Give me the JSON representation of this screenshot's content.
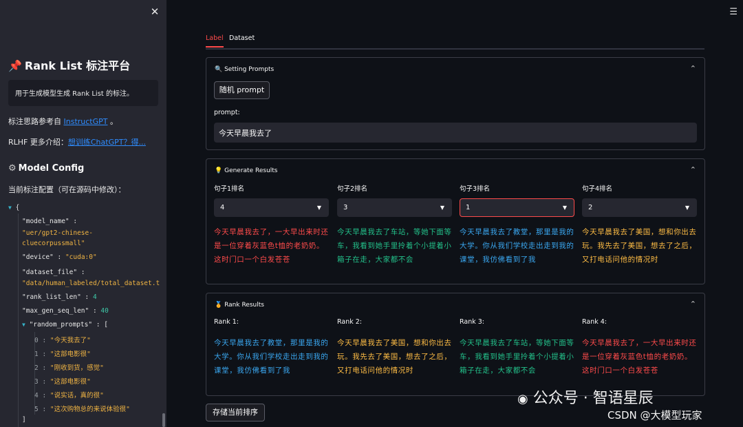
{
  "sidebar": {
    "close_icon": "close-icon",
    "title_icon": "pushpin-icon",
    "title": "Rank List 标注平台",
    "description": "用于生成模型生成 Rank List 的标注。",
    "ref_prefix": "标注思路参考自",
    "ref_link": "InstructGPT",
    "ref_suffix": "。",
    "rlhf_prefix": "RLHF 更多介绍：",
    "rlhf_link": "想训练ChatGPT？得...",
    "config_icon": "gear-icon",
    "config_title": "Model Config",
    "config_caption": "当前标注配置（可在源码中修改）："
  },
  "json": {
    "open": "{",
    "close": "]",
    "model_name_key": "\"model_name\" :",
    "model_name_val_1": "\"uer/gpt2-chinese-",
    "model_name_val_2": "cluecorpussmall\"",
    "device_key": "\"device\" :",
    "device_val": "\"cuda:0\"",
    "dataset_key": "\"dataset_file\" :",
    "dataset_val": "\"data/human_labeled/total_dataset.t",
    "rank_len_key": "\"rank_list_len\" :",
    "rank_len_val": "4",
    "max_gen_key": "\"max_gen_seq_len\" :",
    "max_gen_val": "40",
    "prompts_key": "\"random_prompts\" : [",
    "prompts": [
      {
        "idx": "0 :",
        "val": "\"今天我去了\""
      },
      {
        "idx": "1 :",
        "val": "\"这部电影很\""
      },
      {
        "idx": "2 :",
        "val": "\"刚收到货，感觉\""
      },
      {
        "idx": "3 :",
        "val": "\"这部电影很\""
      },
      {
        "idx": "4 :",
        "val": "\"说实话，真的很\""
      },
      {
        "idx": "5 :",
        "val": "\"这次购物总的来说体验很\""
      }
    ]
  },
  "main": {
    "menu_icon": "hamburger-menu-icon",
    "tabs": [
      {
        "label": "Label"
      },
      {
        "label": "Dataset"
      }
    ],
    "setting": {
      "icon": "magnifier-icon",
      "title": "Setting Prompts",
      "random_button": "随机 prompt",
      "prompt_label": "prompt:",
      "prompt_value": "今天早晨我去了"
    },
    "generate": {
      "icon": "lightbulb-icon",
      "title": "Generate Results",
      "columns": [
        {
          "label": "句子1排名",
          "value": "4",
          "text": "今天早晨我去了，一大早出来时还是一位穿着灰蓝色t恤的老奶奶。这时门口一个白发苍苍"
        },
        {
          "label": "句子2排名",
          "value": "3",
          "text": "今天早晨我去了车站，等她下面等车，我看到她手里拎着个小提着小箱子在走，大家都不会"
        },
        {
          "label": "句子3排名",
          "value": "1",
          "text": "今天早晨我去了教堂，那里是我的大学。你从我们学校走出走到我的课堂，我仿佛看到了我"
        },
        {
          "label": "句子4排名",
          "value": "2",
          "text": "今天早晨我去了美国，想和你出去玩。我先去了美国，想去了之后，又打电话问他的情况时"
        }
      ]
    },
    "rank": {
      "icon": "medal-icon",
      "title": "Rank Results",
      "columns": [
        {
          "label": "Rank 1:",
          "text": "今天早晨我去了教堂，那里是我的大学。你从我们学校走出走到我的课堂，我仿佛看到了我"
        },
        {
          "label": "Rank 2:",
          "text": "今天早晨我去了美国，想和你出去玩。我先去了美国，想去了之后，又打电话问他的情况时"
        },
        {
          "label": "Rank 3:",
          "text": "今天早晨我去了车站，等她下面等车，我看到她手里拎着个小提着小箱子在走，大家都不会"
        },
        {
          "label": "Rank 4:",
          "text": "今天早晨我去了，一大早出来时还是一位穿着灰蓝色t恤的老奶奶。这时门口一个白发苍苍"
        }
      ]
    },
    "save_button": "存储当前排序"
  },
  "watermark": {
    "wechat_icon": "wechat-icon",
    "line1": "公众号 · 智语星辰",
    "line2": "CSDN @大模型玩家"
  },
  "colors": {
    "accent": "#ff4b4b",
    "green": "#23c08a",
    "blue": "#3aa7f0",
    "yellow": "#ffbd45"
  }
}
